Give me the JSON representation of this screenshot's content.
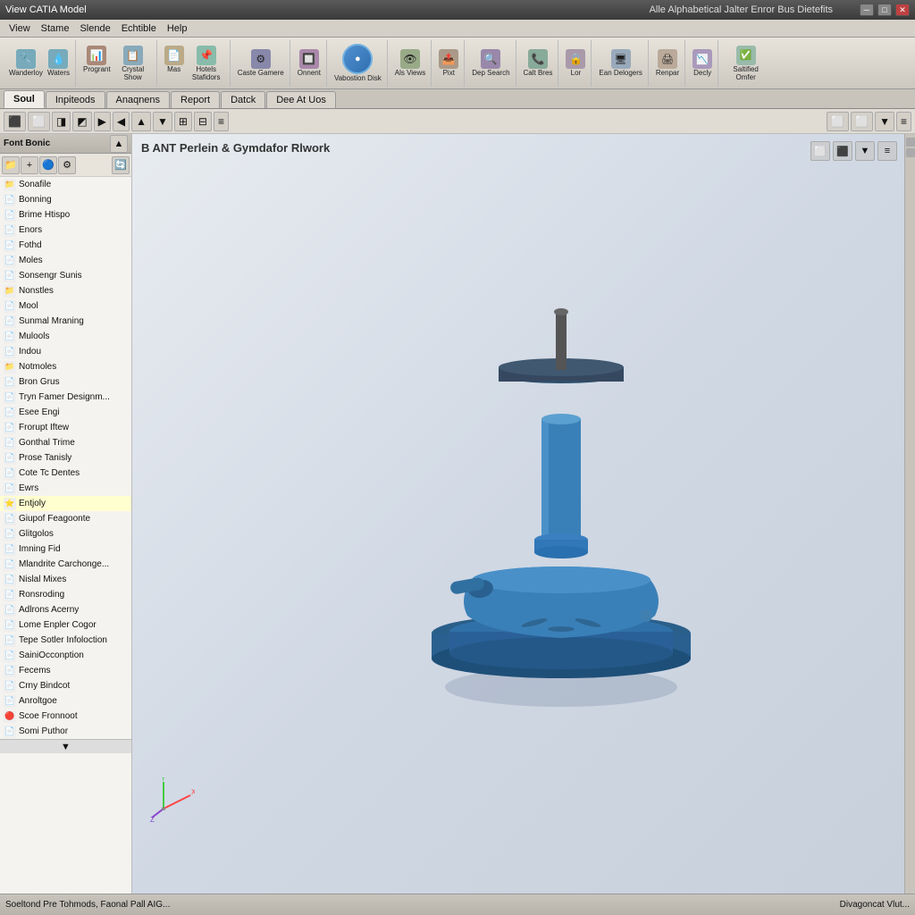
{
  "titlebar": {
    "text": "View CATIA Model",
    "minimize": "─",
    "maximize": "□",
    "close": "✕"
  },
  "menubar": {
    "items": [
      "Stame",
      "Slende",
      "Echtible",
      "Help"
    ]
  },
  "app_title": "Alle Alphabetical Jalter Enror Bus Dietefits",
  "toolbar": {
    "groups": [
      {
        "buttons": [
          {
            "icon": "🔧",
            "label": "Wanderloy"
          },
          {
            "icon": "💧",
            "label": "Waters"
          }
        ]
      },
      {
        "buttons": [
          {
            "icon": "📊",
            "label": "Progrant"
          },
          {
            "icon": "📋",
            "label": "Crystal Show"
          }
        ]
      },
      {
        "buttons": [
          {
            "icon": "📄",
            "label": "Mas"
          },
          {
            "icon": "📌",
            "label": "Hotels Stafidors"
          }
        ]
      },
      {
        "buttons": [
          {
            "icon": "⚙",
            "label": "Caste Gamere"
          }
        ]
      },
      {
        "buttons": [
          {
            "icon": "🔲",
            "label": "Onnent"
          }
        ]
      },
      {
        "buttons": [
          {
            "icon": "🔵",
            "label": "Vabostion Disk"
          }
        ]
      },
      {
        "buttons": [
          {
            "icon": "👁",
            "label": "Als Views"
          }
        ]
      },
      {
        "buttons": [
          {
            "icon": "📤",
            "label": "Pixt"
          }
        ]
      },
      {
        "buttons": [
          {
            "icon": "🔍",
            "label": "Dep Search"
          }
        ]
      },
      {
        "buttons": [
          {
            "icon": "📞",
            "label": "Calt Bres"
          }
        ]
      },
      {
        "buttons": [
          {
            "icon": "🔒",
            "label": "Lor"
          }
        ]
      },
      {
        "buttons": [
          {
            "icon": "🖥",
            "label": "Ean Delogers"
          }
        ]
      },
      {
        "buttons": [
          {
            "icon": "🖨",
            "label": "Renpar"
          }
        ]
      },
      {
        "buttons": [
          {
            "icon": "📉",
            "label": "Decly"
          }
        ]
      },
      {
        "buttons": [
          {
            "icon": "✅",
            "label": "Saltified Omfer"
          }
        ]
      }
    ]
  },
  "tabs": [
    {
      "label": "Soul",
      "active": true
    },
    {
      "label": "Inpiteods"
    },
    {
      "label": "Anaqnens"
    },
    {
      "label": "Report"
    },
    {
      "label": "Datck"
    },
    {
      "label": "Dee At Uos"
    }
  ],
  "secondary_toolbar": {
    "buttons": [
      "⬛",
      "⬜",
      "◨",
      "◩",
      "◪",
      "◫",
      "▶",
      "◀",
      "▲",
      "▼",
      "⊞",
      "⊟",
      "⊠",
      "⊡",
      "≡"
    ]
  },
  "viewport_title": "B ANT Perlein & Gymdafor Rlwork",
  "sidebar": {
    "header": "Font Bonic",
    "items": [
      {
        "label": "Sonafile",
        "icon": "📁",
        "color": "#4a90d9",
        "expandable": false
      },
      {
        "label": "Bonning",
        "icon": "📄",
        "color": "#4a90d9",
        "expandable": false
      },
      {
        "label": "Brime Htispo",
        "icon": "📄",
        "color": "#4a90d9",
        "expandable": false
      },
      {
        "label": "Enors",
        "icon": "📄",
        "color": "#e88",
        "expandable": false
      },
      {
        "label": "Fothd",
        "icon": "📄",
        "color": "#4a90d9",
        "expandable": false
      },
      {
        "label": "Moles",
        "icon": "📄",
        "color": "#4a90d9",
        "expandable": false
      },
      {
        "label": "Sonsengr Sunis",
        "icon": "📄",
        "color": "#4a90d9",
        "expandable": false
      },
      {
        "label": "Nonstles",
        "icon": "📁",
        "color": "#e8a020",
        "expandable": false
      },
      {
        "label": "Mool",
        "icon": "📄",
        "color": "#4a90d9",
        "expandable": false
      },
      {
        "label": "Sunmal Mraning",
        "icon": "📄",
        "color": "#4a90d9",
        "expandable": false
      },
      {
        "label": "Mulools",
        "icon": "📄",
        "color": "#4a90d9",
        "expandable": false
      },
      {
        "label": "Indou",
        "icon": "📄",
        "color": "#4a90d9",
        "expandable": false
      },
      {
        "label": "Notmoles",
        "icon": "📁",
        "color": "#e8a020",
        "expandable": false
      },
      {
        "label": "Bron Grus",
        "icon": "📄",
        "color": "#e8a020",
        "expandable": false
      },
      {
        "label": "Tryn Famer Designm...",
        "icon": "📄",
        "color": "#e8c820",
        "expandable": false
      },
      {
        "label": "Esee Engi",
        "icon": "📄",
        "color": "#4a90d9",
        "expandable": false
      },
      {
        "label": "Frorupt Iftew",
        "icon": "📄",
        "color": "#4a90d9",
        "expandable": false
      },
      {
        "label": "Gonthal Trime",
        "icon": "📄",
        "color": "#e88",
        "expandable": false
      },
      {
        "label": "Prose Tanisly",
        "icon": "📄",
        "color": "#4a90d9",
        "expandable": false
      },
      {
        "label": "Cote Tc Dentes",
        "icon": "📄",
        "color": "#4a90d9",
        "expandable": false
      },
      {
        "label": "Ewrs",
        "icon": "📄",
        "color": "#4a90d9",
        "expandable": false
      },
      {
        "label": "Entjoly",
        "icon": "⭐",
        "color": "#e8c820",
        "expandable": false
      },
      {
        "label": "Giupof Feagoonte",
        "icon": "📄",
        "color": "#e88",
        "expandable": false
      },
      {
        "label": "Glitgolos",
        "icon": "📄",
        "color": "#4a90d9",
        "expandable": false
      },
      {
        "label": "Imning Fid",
        "icon": "📄",
        "color": "#4a90d9",
        "expandable": false
      },
      {
        "label": "Mlandrite Carchonge...",
        "icon": "📄",
        "color": "#4a90d9",
        "expandable": false
      },
      {
        "label": "Nislal Mixes",
        "icon": "📄",
        "color": "#4a90d9",
        "expandable": false
      },
      {
        "label": "Ronsroding",
        "icon": "📄",
        "color": "#4a90d9",
        "expandable": false
      },
      {
        "label": "Adlrons Acerny",
        "icon": "📄",
        "color": "#4a90d9",
        "expandable": false
      },
      {
        "label": "Lome Enpler Cogor",
        "icon": "📄",
        "color": "#4a90d9",
        "expandable": false
      },
      {
        "label": "Tepe Sotler Infoloction",
        "icon": "📄",
        "color": "#4a90d9",
        "expandable": false
      },
      {
        "label": "SainiOcconption",
        "icon": "📄",
        "color": "#4a90d9",
        "expandable": false
      },
      {
        "label": "Fecems",
        "icon": "📄",
        "color": "#4a90d9",
        "expandable": false
      },
      {
        "label": "Crny Bindcot",
        "icon": "📄",
        "color": "#4a90d9",
        "expandable": false
      },
      {
        "label": "Anroltgoe",
        "icon": "📄",
        "color": "#4a90d9",
        "expandable": false
      },
      {
        "label": "Scoe Fronnoot",
        "icon": "🔴",
        "color": "#e84040",
        "expandable": false
      },
      {
        "label": "Somi Puthor",
        "icon": "📄",
        "color": "#4a90d9",
        "expandable": false
      }
    ]
  },
  "statusbar": {
    "left": "Soeltond Pre Tohmods, Faonal Pall AIG...",
    "right": "Divagoncat Vlut..."
  },
  "axes": {
    "x_color": "#ff4444",
    "y_color": "#44cc44",
    "z_color": "#4444ff"
  }
}
